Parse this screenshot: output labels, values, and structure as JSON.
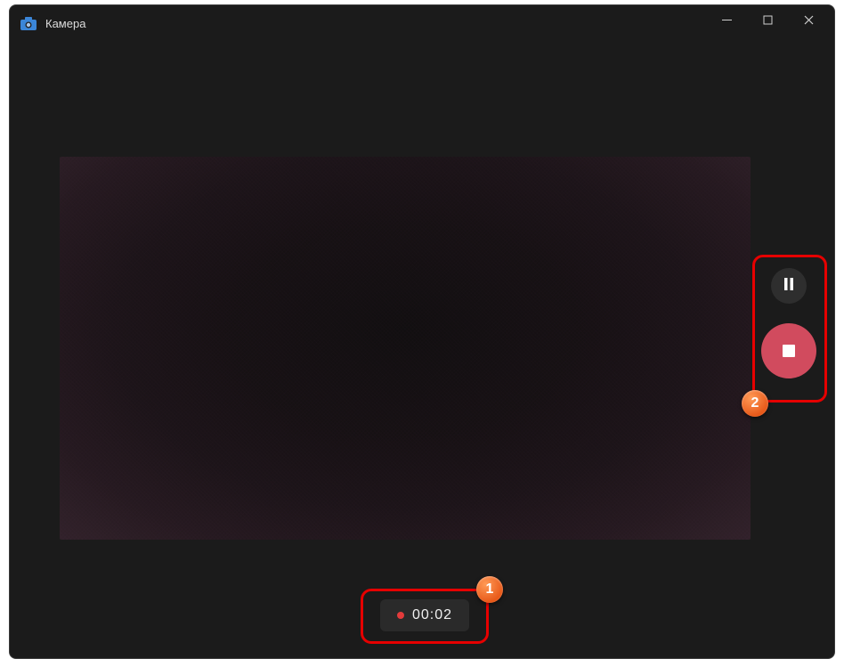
{
  "window": {
    "app_title": "Камера"
  },
  "recording": {
    "timer_text": "00:02"
  },
  "annotations": {
    "badge1": "1",
    "badge2": "2"
  }
}
